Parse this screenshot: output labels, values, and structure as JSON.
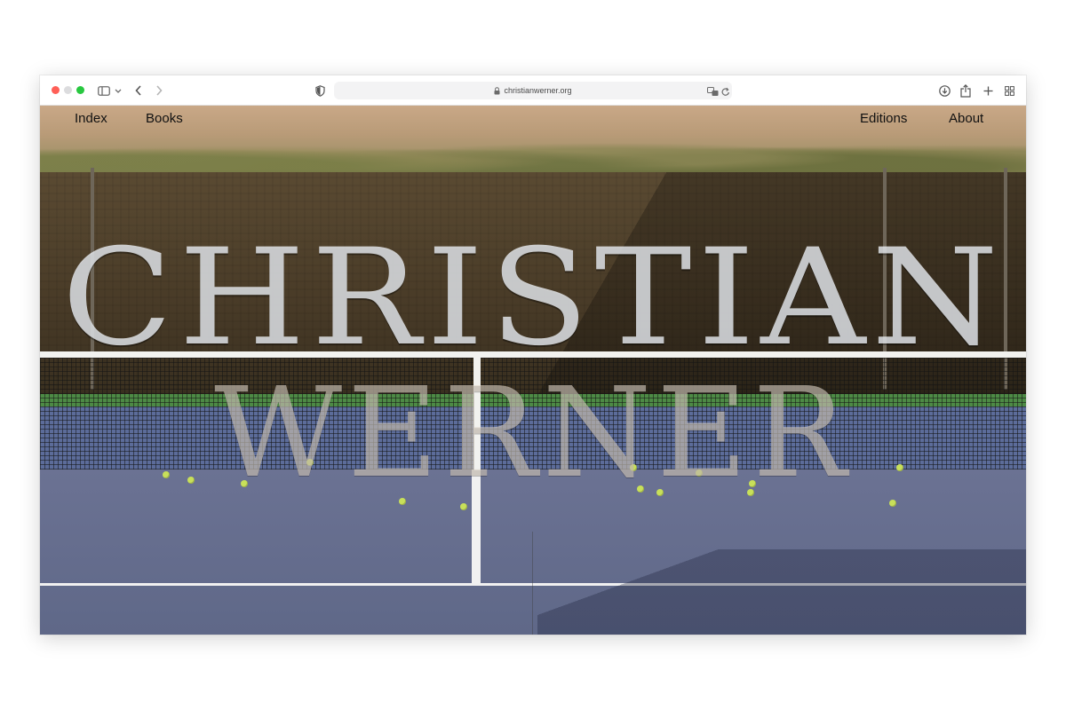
{
  "browser": {
    "url": "christianwerner.org"
  },
  "nav": {
    "index": "Index",
    "books": "Books",
    "editions": "Editions",
    "about": "About"
  },
  "hero": {
    "first_name": "CHRISTIAN",
    "last_name": "WERNER"
  },
  "colors": {
    "close": "#ff5f57",
    "minimize": "#dcdcde",
    "zoom": "#28c840",
    "court_blue": "#5f6888",
    "court_green": "#4d8a45"
  }
}
